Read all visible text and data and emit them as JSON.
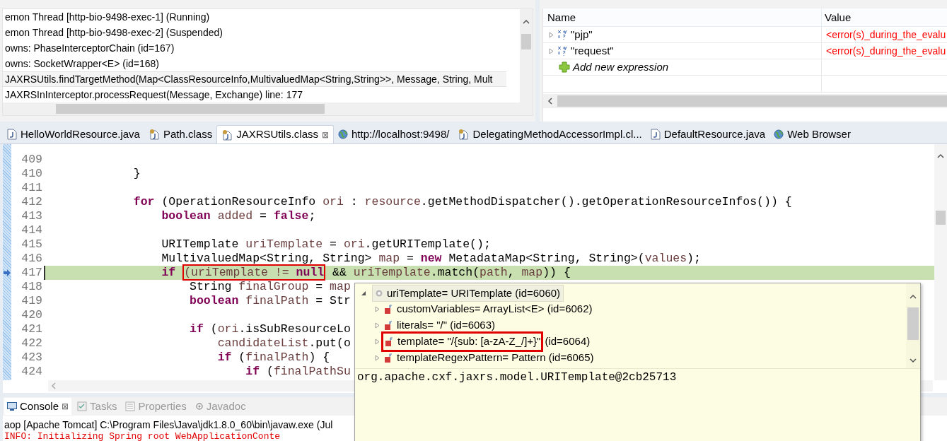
{
  "debug_tree": {
    "rows": [
      {
        "text": "emon Thread [http-bio-9498-exec-1] (Running)",
        "selected": false
      },
      {
        "text": "emon Thread [http-bio-9498-exec-2] (Suspended)",
        "selected": false
      },
      {
        "text": "owns: PhaseInterceptorChain  (id=167)",
        "selected": false
      },
      {
        "text": "owns: SocketWrapper<E>  (id=168)",
        "selected": false
      },
      {
        "text": "JAXRSUtils.findTargetMethod(Map<ClassResourceInfo,MultivaluedMap<String,String>>, Message, String, Mult",
        "selected": true
      },
      {
        "text": "JAXRSInInterceptor.processRequest(Message, Exchange) line: 177",
        "selected": false
      }
    ]
  },
  "expressions": {
    "columns": [
      "Name",
      "Value"
    ],
    "rows": [
      {
        "kind": "expression",
        "name": "\"pjp\"",
        "value": "<error(s)_during_the_evalu"
      },
      {
        "kind": "expression",
        "name": "\"request\"",
        "value": "<error(s)_during_the_evalu"
      },
      {
        "kind": "add",
        "name": "Add new expression"
      }
    ]
  },
  "editor_tabs": [
    {
      "kind": "java",
      "label": "HelloWorldResource.java",
      "selected": false
    },
    {
      "kind": "class",
      "label": "Path.class",
      "selected": false
    },
    {
      "kind": "class",
      "label": "JAXRSUtils.class",
      "selected": true,
      "close": "⊠"
    },
    {
      "kind": "web",
      "label": "http://localhost:9498/",
      "selected": false
    },
    {
      "kind": "class",
      "label": "DelegatingMethodAccessorImpl.cl...",
      "selected": false
    },
    {
      "kind": "java",
      "label": "DefaultResource.java",
      "selected": false
    },
    {
      "kind": "web",
      "label": "Web Browser",
      "selected": false
    }
  ],
  "code_lines": [
    {
      "number": "409",
      "current": false
    },
    {
      "number": "410",
      "current": false,
      "tokens": [
        {
          "kind": "plain",
          "text": "            }"
        }
      ]
    },
    {
      "number": "411",
      "current": false
    },
    {
      "number": "412",
      "current": false,
      "tokens": [
        {
          "kind": "keyword",
          "text": "            for"
        },
        {
          "kind": "plain",
          "text": " (OperationResourceInfo"
        },
        {
          "kind": "variable",
          "text": " ori"
        },
        {
          "kind": "plain",
          "text": " :"
        },
        {
          "kind": "variable",
          "text": " resource"
        },
        {
          "kind": "plain",
          "text": ".getMethodDispatcher().getOperationResourceInfos()) {"
        }
      ]
    },
    {
      "number": "413",
      "current": false,
      "tokens": [
        {
          "kind": "keyword",
          "text": "                boolean"
        },
        {
          "kind": "variable",
          "text": " added"
        },
        {
          "kind": "plain",
          "text": " ="
        },
        {
          "kind": "keyword",
          "text": " false"
        },
        {
          "kind": "plain",
          "text": ";"
        }
      ]
    },
    {
      "number": "414",
      "current": false
    },
    {
      "number": "415",
      "current": false,
      "tokens": [
        {
          "kind": "plain",
          "text": "                URITemplate"
        },
        {
          "kind": "variable",
          "text": " uriTemplate"
        },
        {
          "kind": "plain",
          "text": " ="
        },
        {
          "kind": "variable",
          "text": " ori"
        },
        {
          "kind": "plain",
          "text": ".getURITemplate();"
        }
      ]
    },
    {
      "number": "416",
      "current": false,
      "tokens": [
        {
          "kind": "plain",
          "text": "                MultivaluedMap<String, String>"
        },
        {
          "kind": "variable",
          "text": " map"
        },
        {
          "kind": "plain",
          "text": " ="
        },
        {
          "kind": "keyword",
          "text": " new"
        },
        {
          "kind": "plain",
          "text": " MetadataMap<String, String>("
        },
        {
          "kind": "variable",
          "text": "values"
        },
        {
          "kind": "plain",
          "text": ");"
        }
      ]
    },
    {
      "number": "417",
      "current": true,
      "tokens": [
        {
          "kind": "keyword",
          "text": "                if "
        },
        {
          "kind": "boxed",
          "text": "(uriTemplate != **null**"
        },
        {
          "kind": "plain",
          "text": " &&"
        },
        {
          "kind": "variable",
          "text": " uriTemplate"
        },
        {
          "kind": "plain",
          "text": ".match("
        },
        {
          "kind": "variable",
          "text": "path"
        },
        {
          "kind": "plain",
          "text": ","
        },
        {
          "kind": "variable",
          "text": " map"
        },
        {
          "kind": "plain",
          "text": ")) {"
        }
      ]
    },
    {
      "number": "418",
      "current": false,
      "tokens": [
        {
          "kind": "plain",
          "text": "                    String"
        },
        {
          "kind": "variable",
          "text": " finalGroup"
        },
        {
          "kind": "plain",
          "text": " ="
        },
        {
          "kind": "variable",
          "text": " map"
        }
      ]
    },
    {
      "number": "419",
      "current": false,
      "tokens": [
        {
          "kind": "keyword",
          "text": "                    boolean"
        },
        {
          "kind": "variable",
          "text": " finalPath"
        },
        {
          "kind": "plain",
          "text": " = Str"
        }
      ]
    },
    {
      "number": "420",
      "current": false
    },
    {
      "number": "421",
      "current": false,
      "tokens": [
        {
          "kind": "keyword",
          "text": "                    if"
        },
        {
          "kind": "plain",
          "text": " ("
        },
        {
          "kind": "variable",
          "text": "ori"
        },
        {
          "kind": "plain",
          "text": ".isSubResourceLo"
        }
      ]
    },
    {
      "number": "422",
      "current": false,
      "tokens": [
        {
          "kind": "variable",
          "text": "                        candidateList"
        },
        {
          "kind": "plain",
          "text": ".put(o"
        }
      ]
    },
    {
      "number": "423",
      "current": false,
      "tokens": [
        {
          "kind": "keyword",
          "text": "                        if"
        },
        {
          "kind": "plain",
          "text": " ("
        },
        {
          "kind": "variable",
          "text": "finalPath"
        },
        {
          "kind": "plain",
          "text": ") {"
        }
      ]
    },
    {
      "number": "424",
      "current": false,
      "tokens": [
        {
          "kind": "keyword",
          "text": "                            if"
        },
        {
          "kind": "plain",
          "text": " ("
        },
        {
          "kind": "variable",
          "text": "finalPathSu"
        }
      ]
    }
  ],
  "hover_popup": {
    "root": {
      "text": "uriTemplate= URITemplate  (id=6060)",
      "expanded": true
    },
    "children": [
      {
        "text": "customVariables= ArrayList<E>  (id=6062)",
        "boxed": false
      },
      {
        "text": "literals= \"/\" (id=6063)",
        "boxed": false
      },
      {
        "text": "template= \"/{sub: [a-zA-Z_/]+}\"",
        "suffix": "(id=6064)",
        "boxed": true
      },
      {
        "text": "templateRegexPattern= Pattern  (id=6065)",
        "boxed": false
      }
    ],
    "detail": "org.apache.cxf.jaxrs.model.URITemplate@2cb25713"
  },
  "bottom_tabs": [
    {
      "kind": "console",
      "label": "Console",
      "selected": true,
      "close": "⊠"
    },
    {
      "kind": "tasks",
      "label": "Tasks",
      "selected": false
    },
    {
      "kind": "properties",
      "label": "Properties",
      "selected": false
    },
    {
      "kind": "javadoc",
      "label": "Javadoc",
      "selected": false
    }
  ],
  "console": {
    "process": "aop [Apache Tomcat] C:\\Program Files\\Java\\jdk1.8.0_60\\bin\\javaw.exe (Jul",
    "lines": [
      "INFO: Initializing Spring root WebApplicationConte"
    ]
  }
}
